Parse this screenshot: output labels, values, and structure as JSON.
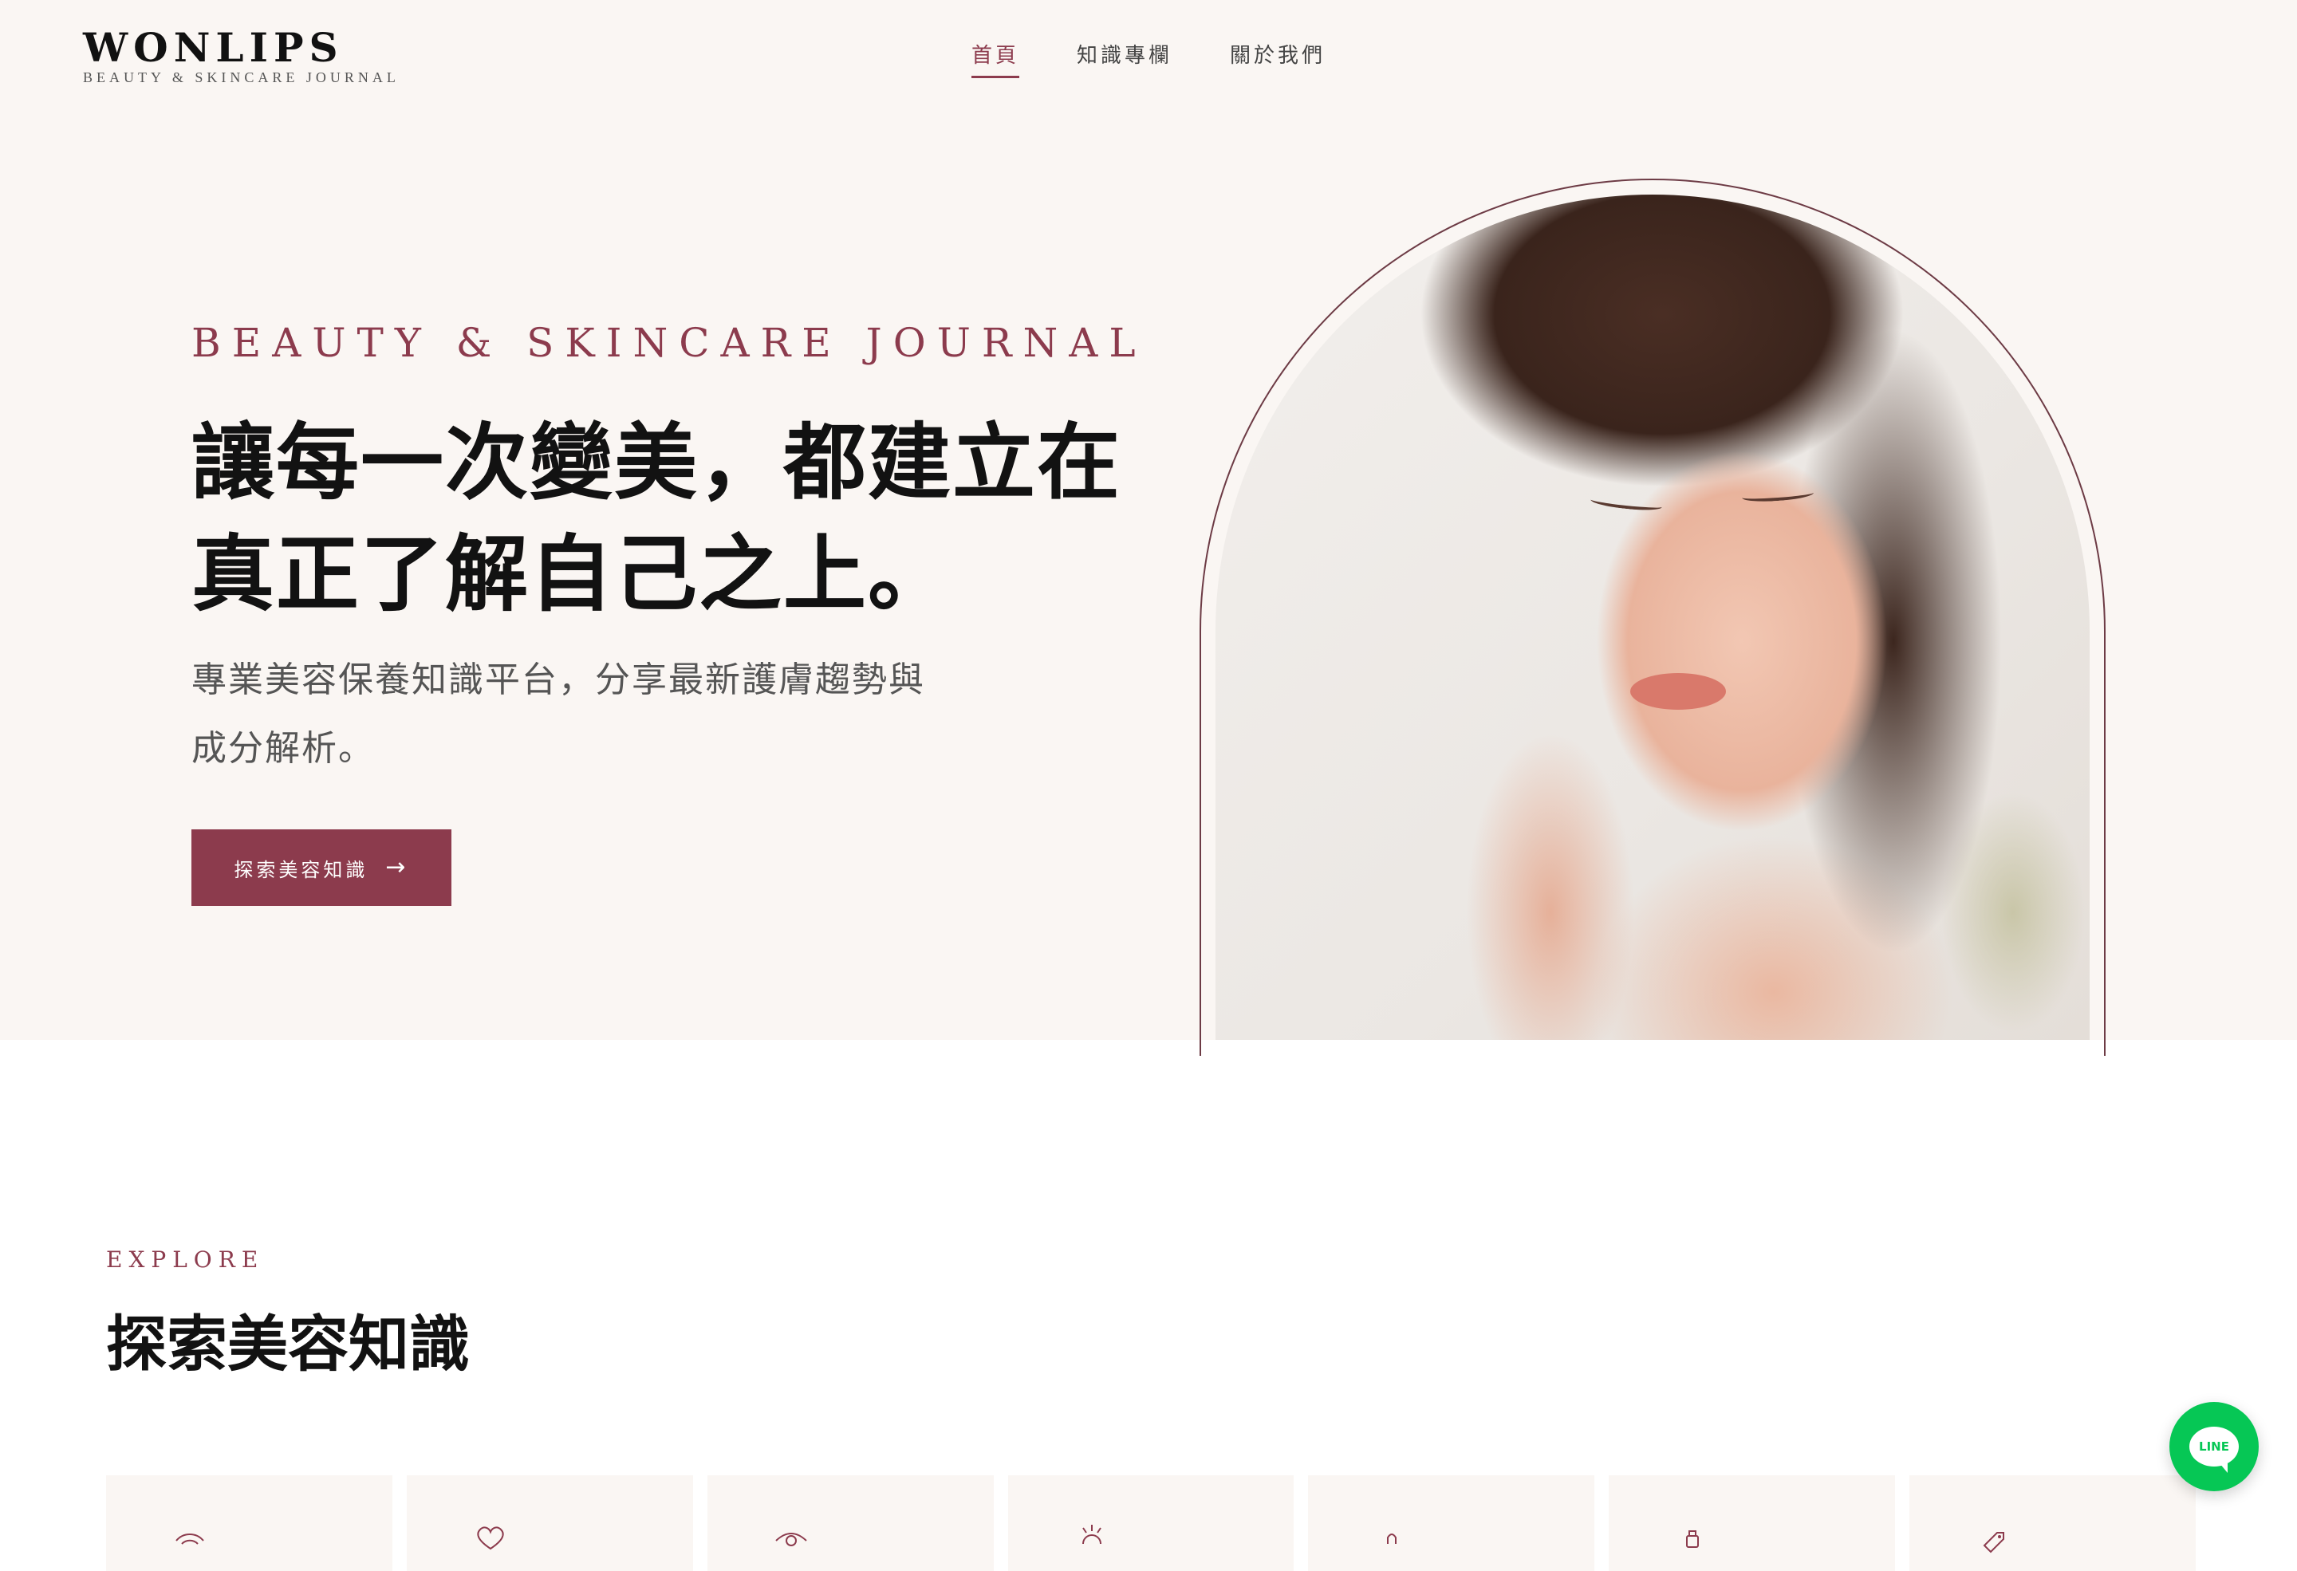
{
  "brand": {
    "name": "WONLIPS",
    "tagline": "BEAUTY & SKINCARE JOURNAL"
  },
  "nav": {
    "items": [
      {
        "label": "首頁",
        "active": true
      },
      {
        "label": "知識專欄",
        "active": false
      },
      {
        "label": "關於我們",
        "active": false
      }
    ]
  },
  "hero": {
    "eyebrow": "BEAUTY & SKINCARE JOURNAL",
    "headline_line1": "讓每一次變美，都建立在",
    "headline_line2": "真正了解自己之上。",
    "subtitle": "專業美容保養知識平台，分享最新護膚趨勢與成分解析。",
    "cta_label": "探索美容知識",
    "cta_arrow": "→",
    "image": "woman-touching-face-skincare-photo"
  },
  "explore": {
    "eyebrow": "EXPLORE",
    "title": "探索美容知識",
    "cards": [
      {
        "icon": "wifi-arc-icon"
      },
      {
        "icon": "heart-icon"
      },
      {
        "icon": "eye-icon"
      },
      {
        "icon": "sun-rays-icon"
      },
      {
        "icon": "dropper-icon"
      },
      {
        "icon": "bottle-icon"
      },
      {
        "icon": "tag-icon"
      }
    ]
  },
  "floating": {
    "line_label": "LINE"
  },
  "colors": {
    "accent": "#8c3b4d",
    "hero_bg": "#faf6f3",
    "line_green": "#06c755"
  }
}
